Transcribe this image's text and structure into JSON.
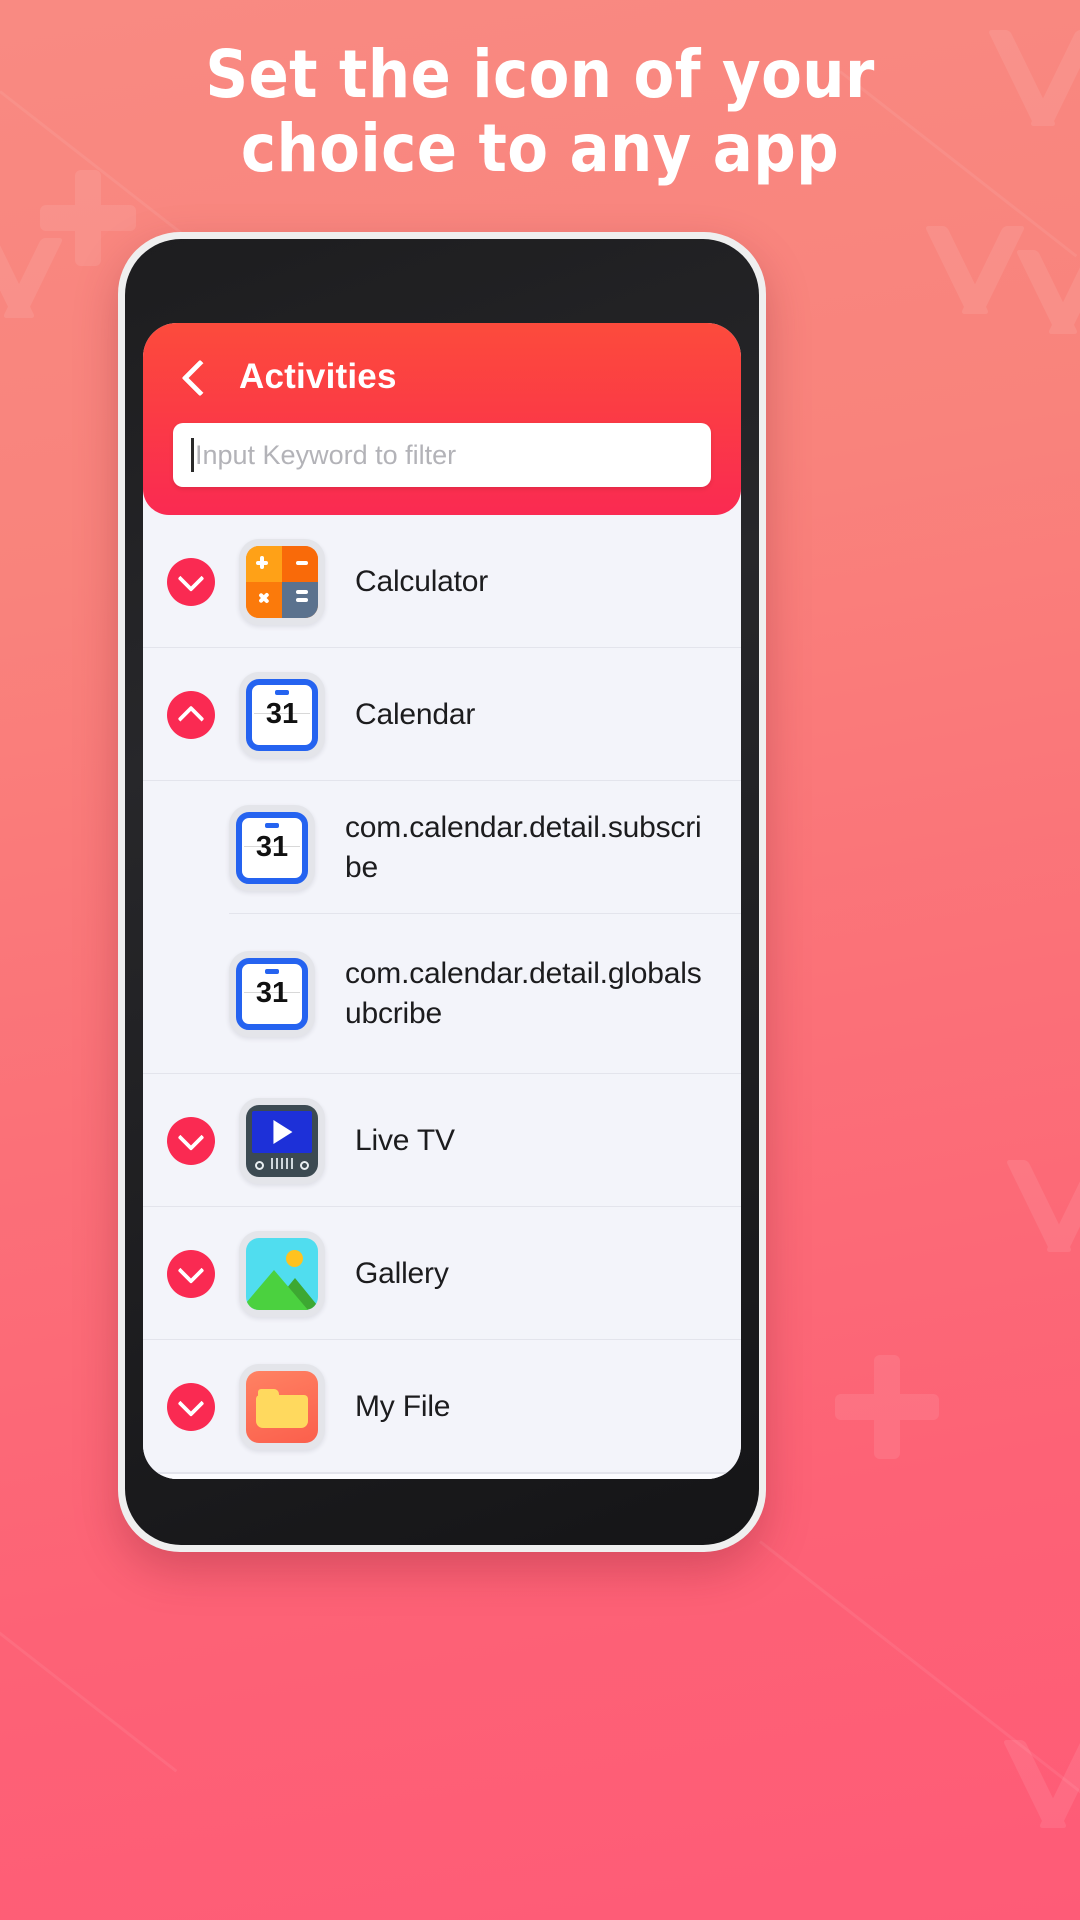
{
  "promo": {
    "headline_line1": "Set the icon of your",
    "headline_line2": "choice to any app",
    "background_color_top": "#f98a82",
    "background_color_bottom": "#fe5b77"
  },
  "app": {
    "header": {
      "back_icon": "chevron-left-icon",
      "title": "Activities",
      "gradient_top": "#fc4b3c",
      "gradient_bottom": "#fa2a52"
    },
    "search": {
      "value": "",
      "placeholder": "Input Keyword to filter"
    },
    "list": [
      {
        "label": "Calculator",
        "icon": "calculator-icon",
        "expanded": false,
        "chevron": "chevron-down-icon",
        "children": []
      },
      {
        "label": "Calendar",
        "icon": "calendar-icon",
        "expanded": true,
        "chevron": "chevron-up-icon",
        "children": [
          {
            "label": "com.calendar.detail.subscribe",
            "icon": "calendar-icon"
          },
          {
            "label": "com.calendar.detail.globalsubcribe",
            "icon": "calendar-icon"
          }
        ]
      },
      {
        "label": "Live TV",
        "icon": "live-tv-icon",
        "expanded": false,
        "chevron": "chevron-down-icon",
        "children": []
      },
      {
        "label": "Gallery",
        "icon": "gallery-icon",
        "expanded": false,
        "chevron": "chevron-down-icon",
        "children": []
      },
      {
        "label": "My File",
        "icon": "folder-icon",
        "expanded": false,
        "chevron": "chevron-down-icon",
        "children": []
      }
    ],
    "calendar_day": "31",
    "accent_color": "#fa2a52"
  }
}
